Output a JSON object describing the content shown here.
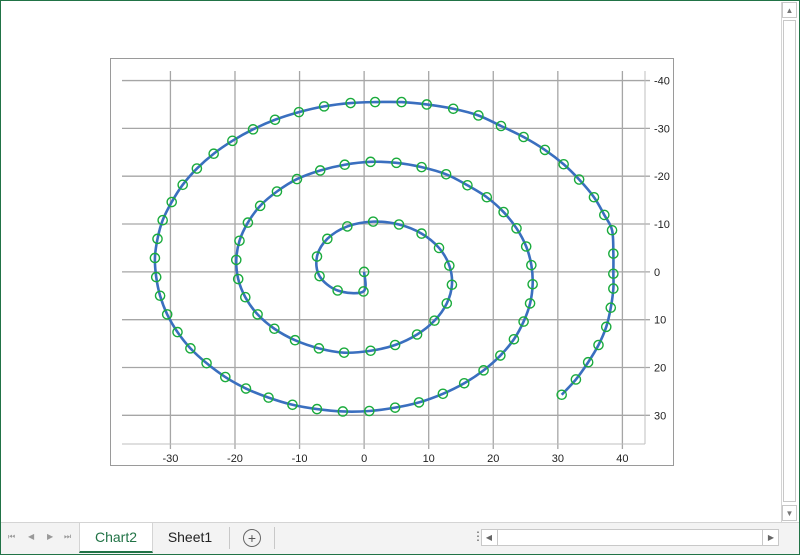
{
  "sheet_tabs": [
    {
      "label": "Chart2",
      "active": true
    },
    {
      "label": "Sheet1",
      "active": false
    }
  ],
  "icons": {
    "first": "first-sheet-icon",
    "prev": "prev-sheet-icon",
    "next": "next-sheet-icon",
    "last": "last-sheet-icon",
    "add": "plus-circle-icon"
  },
  "colors": {
    "accent": "#217346",
    "line": "#3a6fbf",
    "marker": "#1aab3c",
    "grid": "#a6a6a6"
  },
  "chart_data": {
    "type": "scatter",
    "style": "smooth line with circle markers",
    "x_ticks": [
      -30,
      -20,
      -10,
      0,
      10,
      20,
      30,
      40
    ],
    "y_ticks": [
      -40,
      -30,
      -20,
      -10,
      0,
      10,
      20,
      30
    ],
    "xlim": [
      -37.5,
      43.5
    ],
    "ylim": [
      -42,
      36
    ],
    "y_reversed": true,
    "y_axis_position": "right",
    "grid": true,
    "legend": "none",
    "points": [
      [
        0,
        0
      ],
      [
        -0.1,
        4.1
      ],
      [
        -4.1,
        3.9
      ],
      [
        -6.9,
        0.9
      ],
      [
        -7.3,
        -3.2
      ],
      [
        -5.7,
        -6.9
      ],
      [
        -2.6,
        -9.5
      ],
      [
        1.4,
        -10.5
      ],
      [
        5.4,
        -9.9
      ],
      [
        8.9,
        -8
      ],
      [
        11.6,
        -5
      ],
      [
        13.2,
        -1.3
      ],
      [
        13.6,
        2.7
      ],
      [
        12.8,
        6.6
      ],
      [
        10.9,
        10.2
      ],
      [
        8.2,
        13.1
      ],
      [
        4.8,
        15.3
      ],
      [
        1,
        16.5
      ],
      [
        -3.1,
        16.9
      ],
      [
        -7,
        16
      ],
      [
        -10.7,
        14.3
      ],
      [
        -13.9,
        11.9
      ],
      [
        -16.5,
        8.9
      ],
      [
        -18.4,
        5.3
      ],
      [
        -19.5,
        1.5
      ],
      [
        -19.8,
        -2.5
      ],
      [
        -19.3,
        -6.5
      ],
      [
        -18,
        -10.3
      ],
      [
        -16.1,
        -13.8
      ],
      [
        -13.5,
        -16.8
      ],
      [
        -10.4,
        -19.4
      ],
      [
        -6.8,
        -21.2
      ],
      [
        -3,
        -22.4
      ],
      [
        1,
        -23
      ],
      [
        5,
        -22.8
      ],
      [
        8.9,
        -21.9
      ],
      [
        12.7,
        -20.4
      ],
      [
        16,
        -18.1
      ],
      [
        19,
        -15.6
      ],
      [
        21.6,
        -12.5
      ],
      [
        23.6,
        -9.1
      ],
      [
        25.1,
        -5.3
      ],
      [
        25.9,
        -1.4
      ],
      [
        26.1,
        2.6
      ],
      [
        25.7,
        6.6
      ],
      [
        24.7,
        10.4
      ],
      [
        23.2,
        14.1
      ],
      [
        21.1,
        17.5
      ],
      [
        18.5,
        20.6
      ],
      [
        15.5,
        23.3
      ],
      [
        12.2,
        25.5
      ],
      [
        8.5,
        27.3
      ],
      [
        4.8,
        28.4
      ],
      [
        0.8,
        29.1
      ],
      [
        -3.3,
        29.2
      ],
      [
        -7.3,
        28.7
      ],
      [
        -11.1,
        27.8
      ],
      [
        -14.8,
        26.3
      ],
      [
        -18.3,
        24.4
      ],
      [
        -21.5,
        22
      ],
      [
        -24.4,
        19.1
      ],
      [
        -26.9,
        16
      ],
      [
        -28.9,
        12.6
      ],
      [
        -30.5,
        8.9
      ],
      [
        -31.6,
        5
      ],
      [
        -32.2,
        1.1
      ],
      [
        -32.4,
        -2.9
      ],
      [
        -32,
        -6.9
      ],
      [
        -31.2,
        -10.8
      ],
      [
        -29.8,
        -14.6
      ],
      [
        -28.1,
        -18.2
      ],
      [
        -25.9,
        -21.6
      ],
      [
        -23.3,
        -24.7
      ],
      [
        -20.4,
        -27.4
      ],
      [
        -17.2,
        -29.8
      ],
      [
        -13.8,
        -31.8
      ],
      [
        -10.1,
        -33.4
      ],
      [
        -6.2,
        -34.6
      ],
      [
        -2.1,
        -35.3
      ],
      [
        1.7,
        -35.5
      ],
      [
        5.8,
        -35.5
      ],
      [
        9.7,
        -35
      ],
      [
        13.8,
        -34.1
      ],
      [
        17.7,
        -32.7
      ],
      [
        21.2,
        -30.5
      ],
      [
        24.7,
        -28.2
      ],
      [
        28,
        -25.5
      ],
      [
        30.9,
        -22.5
      ],
      [
        33.3,
        -19.3
      ],
      [
        35.6,
        -15.6
      ],
      [
        37.2,
        -11.9
      ],
      [
        38.4,
        -8.7
      ],
      [
        38.6,
        -3.8
      ],
      [
        38.6,
        0.4
      ],
      [
        38.6,
        3.5
      ],
      [
        38.2,
        7.5
      ],
      [
        37.5,
        11.5
      ],
      [
        36.3,
        15.3
      ],
      [
        34.7,
        18.9
      ],
      [
        32.8,
        22.5
      ],
      [
        30.6,
        25.7
      ]
    ]
  }
}
